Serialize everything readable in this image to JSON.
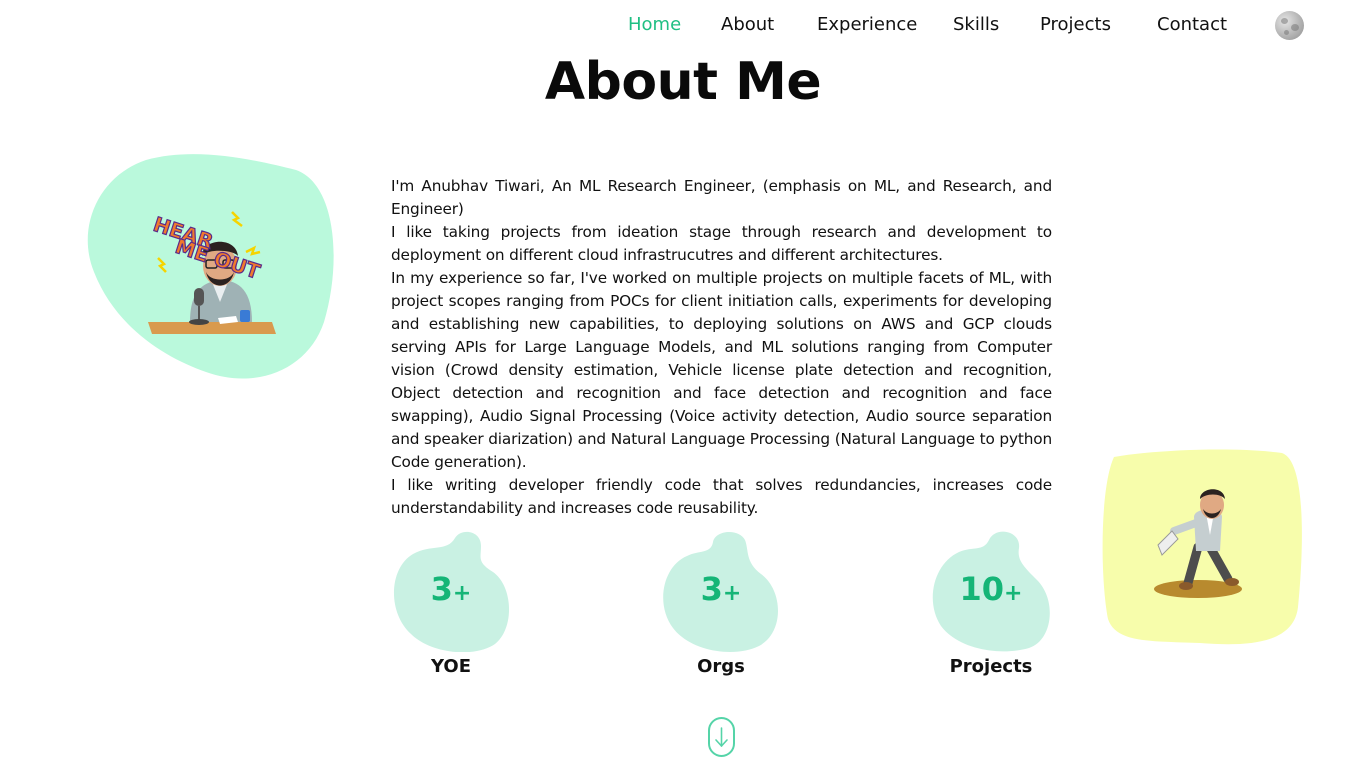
{
  "nav": {
    "items": [
      {
        "label": "Home",
        "active": true
      },
      {
        "label": "About",
        "active": false
      },
      {
        "label": "Experience",
        "active": false
      },
      {
        "label": "Skills",
        "active": false
      },
      {
        "label": "Projects",
        "active": false
      },
      {
        "label": "Contact",
        "active": false
      }
    ],
    "theme_toggle_icon": "moon-icon"
  },
  "page": {
    "title": "About Me"
  },
  "illustrations": {
    "left": "hear-me-out-avatar-illustration",
    "right": "walking-megaphone-avatar-illustration"
  },
  "about": {
    "paragraphs": [
      "I'm Anubhav Tiwari, An ML Research Engineer, (emphasis on ML, and Research, and Engineer)",
      "I like taking projects from ideation stage through research and development to deployment on different cloud infrastrucutres and different architectures.",
      "In my experience so far, I've worked on multiple projects on multiple facets of ML, with project scopes ranging from POCs for client initiation calls, experiments for developing and establishing new capabilities, to deploying solutions on AWS and GCP clouds serving APIs for Large Language Models, and ML solutions ranging from Computer vision (Crowd density estimation, Vehicle license plate detection and recognition, Object detection and recognition and face detection and recognition and face swapping), Audio Signal Processing (Voice activity detection, Audio source separation and speaker diarization) and Natural Language Processing (Natural Language to python Code generation).",
      "I like writing developer friendly code that solves redundancies, increases code understandability and increases code reusability."
    ]
  },
  "stats": [
    {
      "value": "3",
      "suffix": "+",
      "label": "YOE"
    },
    {
      "value": "3",
      "suffix": "+",
      "label": "Orgs"
    },
    {
      "value": "10",
      "suffix": "+",
      "label": "Projects"
    }
  ],
  "scroll_icon": "arrow-down-icon",
  "colors": {
    "accent": "#1fbf83",
    "stat_value": "#15b577",
    "stat_blob": "#c9f1e3",
    "blob_left": "#baf9dc",
    "blob_right": "#f7fdab"
  }
}
